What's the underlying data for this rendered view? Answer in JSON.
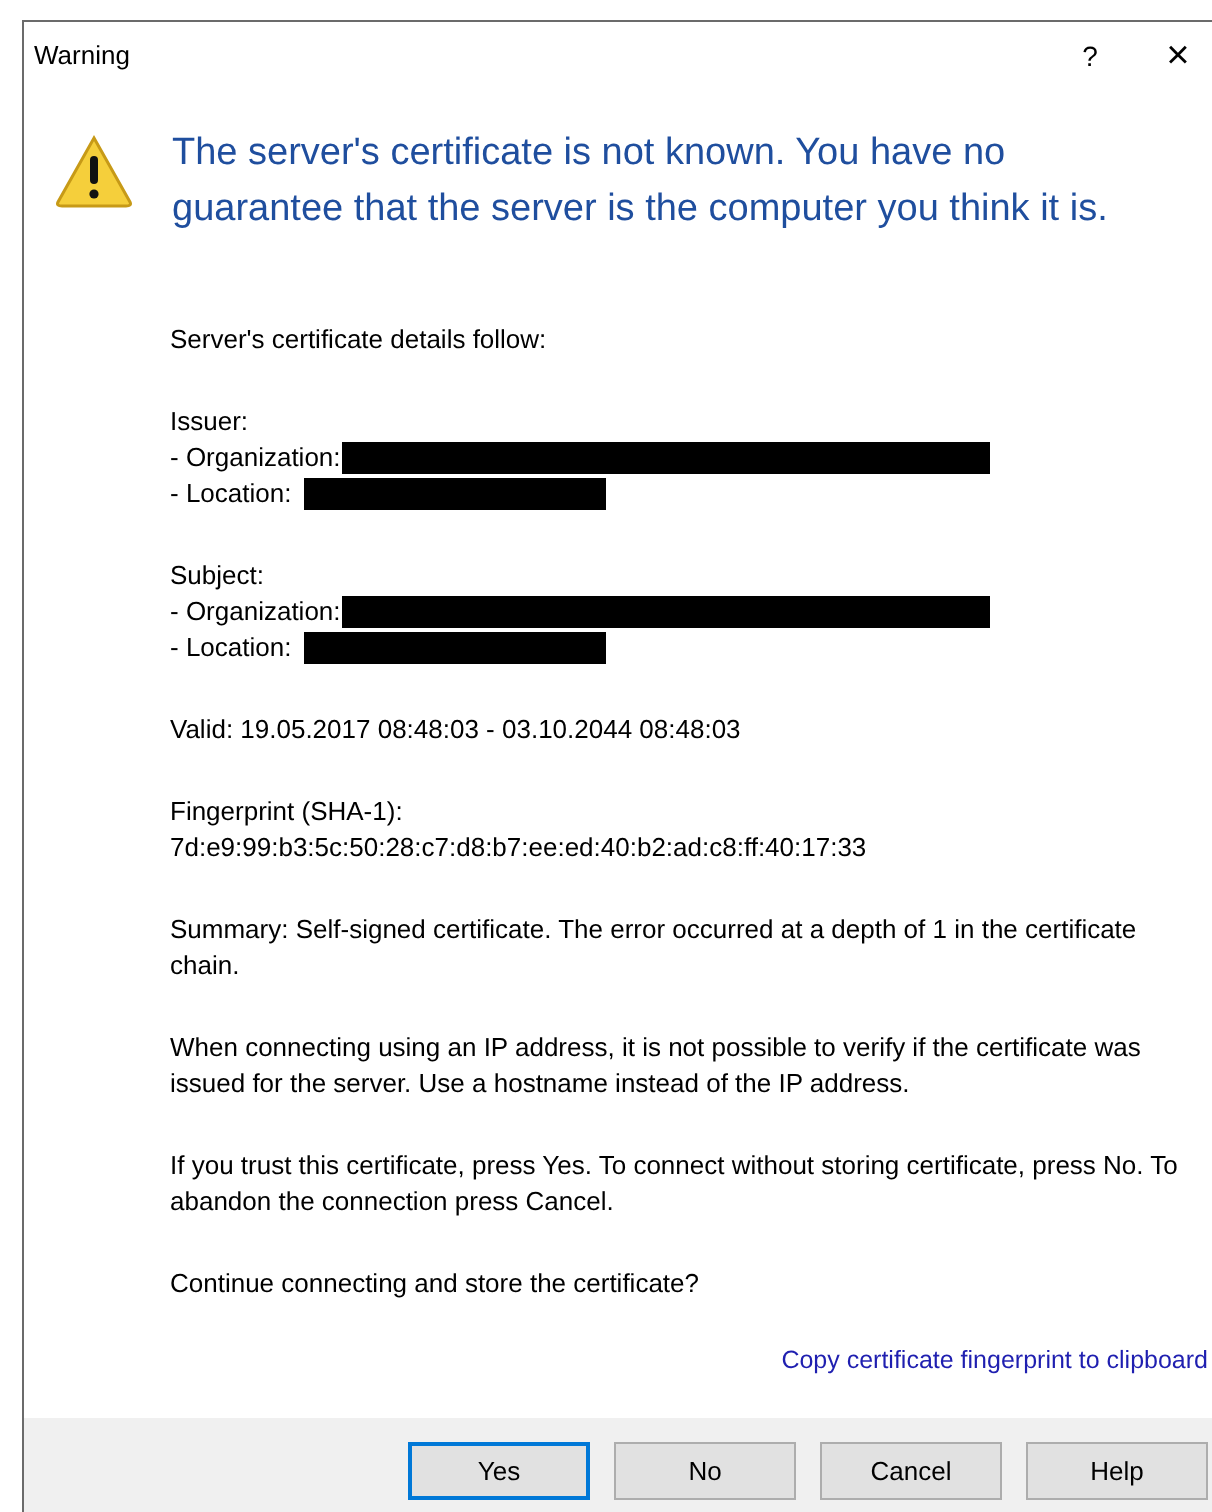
{
  "window": {
    "title": "Warning",
    "help": "?",
    "close": "×"
  },
  "heading": "The server's certificate is not known. You have no guarantee that the server is the computer you think it is.",
  "sections": [
    {
      "lines": [
        {
          "kind": "text",
          "text": "Server's certificate details follow:"
        }
      ]
    },
    {
      "lines": [
        {
          "kind": "text",
          "text": "Issuer:"
        },
        {
          "kind": "field",
          "text": "- Organization:",
          "redacted": true
        },
        {
          "kind": "field",
          "text": "- Location:",
          "redacted": true
        }
      ]
    },
    {
      "lines": [
        {
          "kind": "text",
          "text": "Subject:"
        },
        {
          "kind": "field",
          "text": "- Organization:",
          "redacted": true
        },
        {
          "kind": "field",
          "text": "- Location:",
          "redacted": true
        }
      ]
    },
    {
      "lines": [
        {
          "kind": "text",
          "text": "Valid: 19.05.2017 08:48:03 - 03.10.2044 08:48:03"
        }
      ]
    },
    {
      "lines": [
        {
          "kind": "text",
          "text": "Fingerprint (SHA-1):"
        },
        {
          "kind": "text",
          "text": "7d:e9:99:b3:5c:50:28:c7:d8:b7:ee:ed:40:b2:ad:c8:ff:40:17:33"
        }
      ]
    },
    {
      "lines": [
        {
          "kind": "text",
          "text": "Summary: Self-signed certificate. The error occurred at a depth of 1 in the certificate chain."
        }
      ]
    },
    {
      "lines": [
        {
          "kind": "text",
          "text": "When connecting using an IP address, it is not possible to verify if the certificate was issued for the server. Use a hostname instead of the IP address."
        }
      ]
    },
    {
      "lines": [
        {
          "kind": "text",
          "text": "If you trust this certificate, press Yes. To connect without storing certificate, press No. To abandon the connection press Cancel."
        }
      ]
    },
    {
      "lines": [
        {
          "kind": "text",
          "text": "Continue connecting and store the certificate?"
        }
      ]
    }
  ],
  "link": "Copy certificate fingerprint to clipboard",
  "buttons": [
    {
      "label": "Yes",
      "default": true
    },
    {
      "label": "No",
      "default": false
    },
    {
      "label": "Cancel",
      "default": false
    },
    {
      "label": "Help",
      "default": false
    }
  ]
}
